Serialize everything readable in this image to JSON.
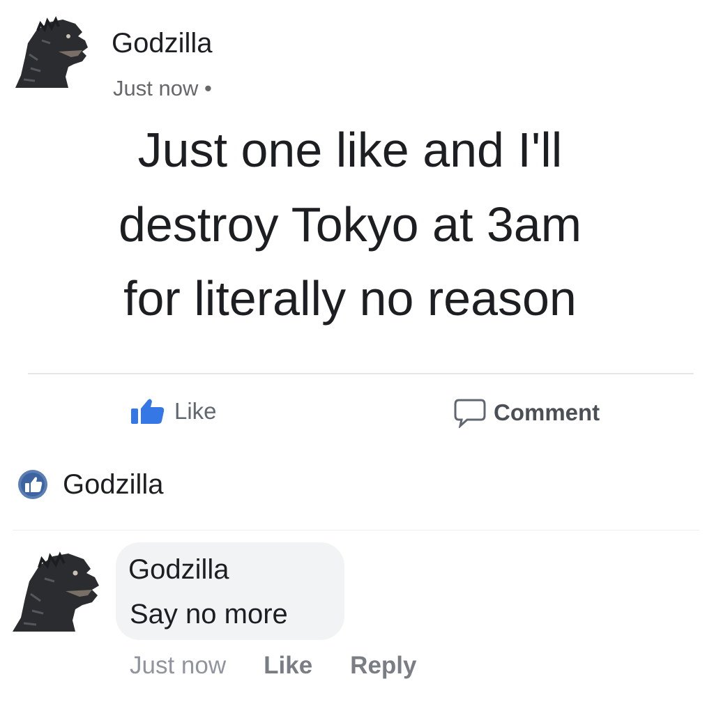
{
  "post": {
    "author": "Godzilla",
    "timestamp": "Just now",
    "separator": "•",
    "text_lines": [
      "Just one like and I'll",
      "destroy Tokyo at 3am",
      "for literally no reason"
    ]
  },
  "actions": {
    "like": {
      "label": "Like",
      "icon": "thumbs-up-icon"
    },
    "comment": {
      "label": "Comment",
      "icon": "comment-icon"
    }
  },
  "reactions": {
    "icon": "like-reaction-icon",
    "names": "Godzilla"
  },
  "comment": {
    "author": "Godzilla",
    "text": "Say no more",
    "timestamp": "Just now",
    "like_label": "Like",
    "reply_label": "Reply"
  },
  "colors": {
    "like_blue": "#3578e5",
    "text": "#1c1e21",
    "meta_gray": "#65676b",
    "bubble": "#f2f3f5"
  }
}
